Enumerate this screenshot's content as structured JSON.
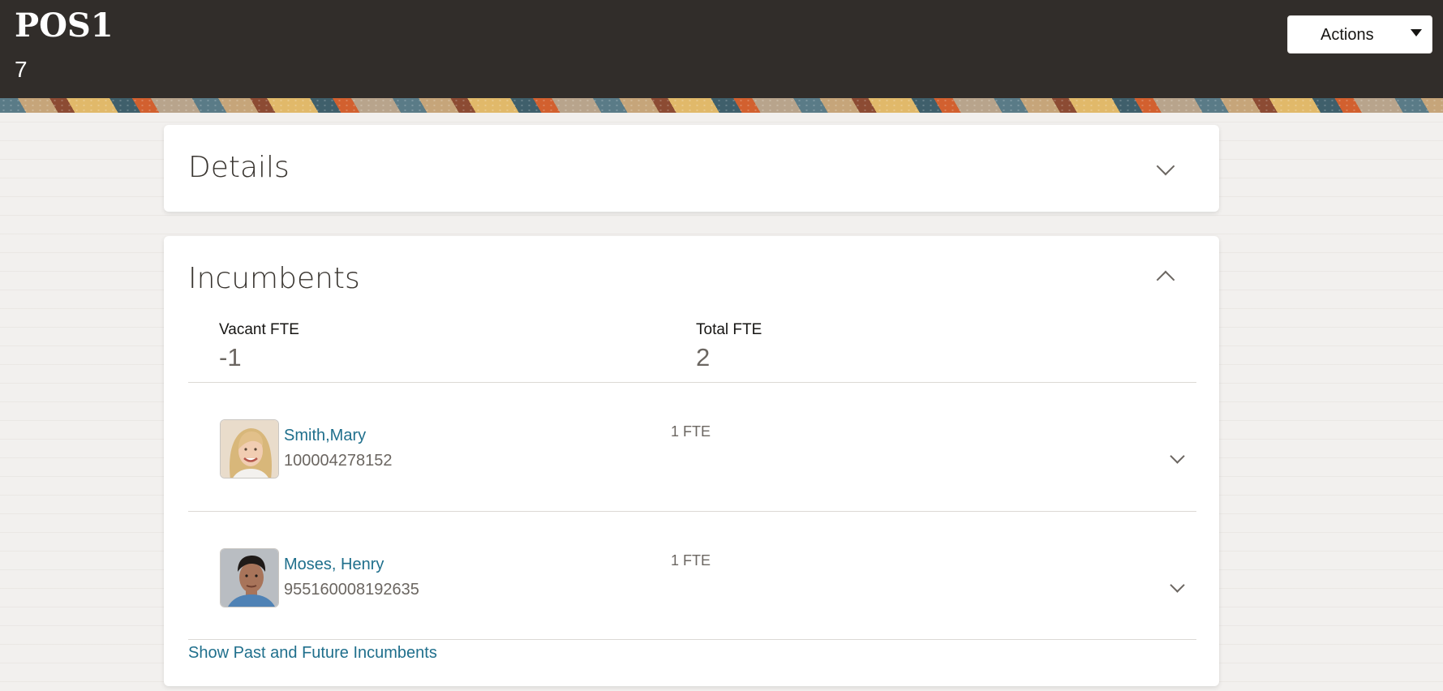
{
  "header": {
    "title": "POS1",
    "subtitle": "7",
    "actions_label": "Actions"
  },
  "details": {
    "title": "Details",
    "toggle_icon": "chevron-down-icon"
  },
  "incumbents": {
    "title": "Incumbents",
    "toggle_icon": "chevron-up-icon",
    "vacant_fte_label": "Vacant FTE",
    "vacant_fte_value": "-1",
    "total_fte_label": "Total FTE",
    "total_fte_value": "2",
    "people": [
      {
        "name": "Smith,Mary",
        "id": "100004278152",
        "fte": "1 FTE"
      },
      {
        "name": "Moses, Henry",
        "id": "955160008192635",
        "fte": "1 FTE"
      }
    ],
    "show_more_link": "Show Past and Future Incumbents"
  },
  "colors": {
    "header_bg": "#312d2a",
    "link": "#1f6f8c",
    "card_bg": "#ffffff"
  }
}
